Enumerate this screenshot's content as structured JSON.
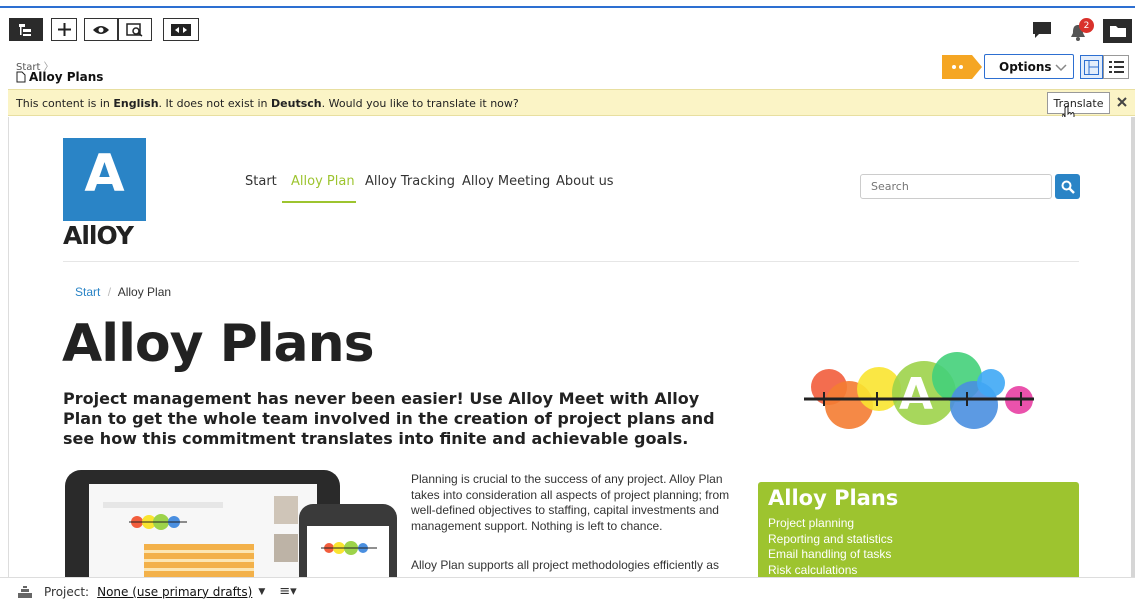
{
  "toolbar": {
    "notification_count": "2",
    "options_label": "Options",
    "project_bar": {
      "label": "Project:",
      "value": "None (use primary drafts)"
    }
  },
  "breadcrumb": {
    "root": "Start",
    "title": "Alloy Plans"
  },
  "banner": {
    "part1": "This content is in ",
    "lang1": "English",
    "part2": ". It does not exist in ",
    "lang2": "Deutsch",
    "part3": ". Would you like to translate it now?",
    "translate_label": "Translate"
  },
  "site": {
    "logo_letter": "A",
    "logo_text": "AllOY",
    "nav": [
      "Start",
      "Alloy Plan",
      "Alloy Tracking",
      "Alloy Meeting",
      "About us"
    ],
    "search_placeholder": "Search",
    "crumbs": {
      "home": "Start",
      "sep": "/",
      "current": "Alloy Plan"
    },
    "heading": "Alloy Plans",
    "lead": "Project management has never been easier! Use Alloy Meet with Alloy Plan to get the whole team involved in the creation of project plans and see how this commitment translates into finite and achievable goals.",
    "para1": "Planning is crucial to the success of any project. Alloy Plan takes into consideration all aspects of project planning; from well-defined objectives to staffing, capital investments and management support. Nothing is left to chance.",
    "para2": "Alloy Plan supports all project methodologies efficiently as",
    "box": {
      "title": "Alloy Plans",
      "items": [
        "Project planning",
        "Reporting and statistics",
        "Email handling of tasks",
        "Risk calculations"
      ]
    },
    "hero_letter": "A"
  },
  "colors": {
    "accent": "#2d6fd1",
    "green": "#9dc42f",
    "banner": "#fbf4c6",
    "logo": "#2a84c6"
  }
}
